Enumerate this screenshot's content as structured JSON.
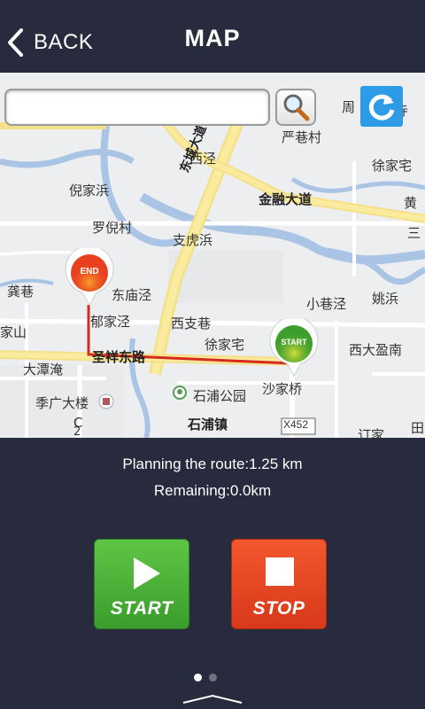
{
  "header": {
    "back_label": "BACK",
    "title": "MAP"
  },
  "search": {
    "value": "",
    "placeholder": ""
  },
  "map": {
    "places": [
      "周",
      "寺",
      "严巷村",
      "西泾",
      "徐家宅",
      "倪家浜",
      "金融大道",
      "黄",
      "罗倪村",
      "三",
      "东城大道",
      "支虎浜",
      "姚浜",
      "龚巷",
      "东庙泾",
      "郁家泾",
      "西支巷",
      "小巷泾",
      "家山",
      "徐家宅",
      "西大盈南",
      "大潭淹",
      "圣祥东路",
      "沙家桥",
      "季广大楼",
      "石浦公园",
      "C",
      "2",
      "石浦镇",
      "X452",
      "订家",
      "田"
    ],
    "end_marker": "END",
    "start_marker": "START"
  },
  "route": {
    "planning_text": "Planning the route:1.25 km",
    "remaining_text": "Remaining:0.0km"
  },
  "controls": {
    "start_label": "START",
    "stop_label": "STOP"
  },
  "pager": {
    "pages": 2,
    "active": 0
  },
  "colors": {
    "background": "#272b3d",
    "start_green": "#4bb33a",
    "stop_red": "#e4482a",
    "refresh_blue": "#2e9be6",
    "route_red": "#d52b1e"
  }
}
